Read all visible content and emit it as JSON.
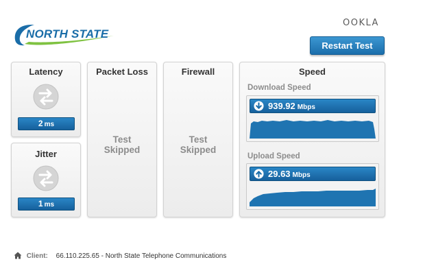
{
  "header": {
    "brand": "NORTH STATE",
    "ookla": "OOKLA",
    "restart_label": "Restart Test"
  },
  "latency": {
    "title": "Latency",
    "value": "2",
    "unit": "ms",
    "icon": "transfer-arrows-icon"
  },
  "jitter": {
    "title": "Jitter",
    "value": "1",
    "unit": "ms",
    "icon": "transfer-arrows-icon"
  },
  "packet_loss": {
    "title": "Packet Loss",
    "status_line1": "Test",
    "status_line2": "Skipped"
  },
  "firewall": {
    "title": "Firewall",
    "status_line1": "Test",
    "status_line2": "Skipped"
  },
  "speed": {
    "title": "Speed",
    "download": {
      "label": "Download Speed",
      "value": "939.92",
      "unit": "Mbps",
      "icon": "arrow-down-icon"
    },
    "upload": {
      "label": "Upload Speed",
      "value": "29.63",
      "unit": "Mbps",
      "icon": "arrow-up-icon"
    }
  },
  "footer": {
    "client_label": "Client:",
    "client_text": "66.110.225.65 - North State Telephone Communications",
    "icon": "home-icon"
  },
  "colors": {
    "accent": "#1b6eab",
    "brand_blue": "#1a6da8",
    "graph_fill": "#1f74b1",
    "panel_bg": "#f0f0f0",
    "muted_text": "#8c8c8c"
  }
}
